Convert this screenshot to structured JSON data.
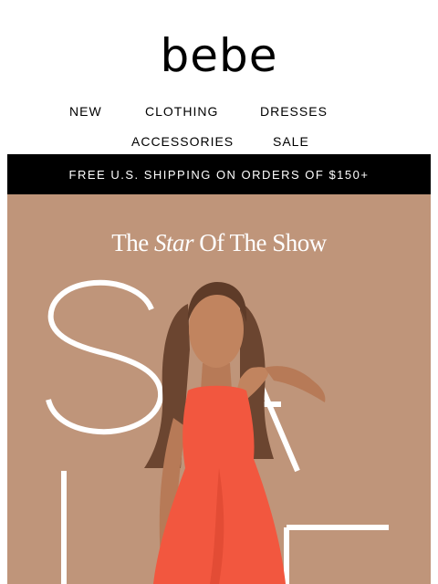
{
  "brand": {
    "logo_text": "bebe"
  },
  "nav": {
    "items": [
      "NEW",
      "CLOTHING",
      "DRESSES",
      "ACCESSORIES",
      "SALE"
    ]
  },
  "promo_banner": {
    "text": "FREE U.S. SHIPPING ON ORDERS OF $150+"
  },
  "hero": {
    "tagline_pre": "The",
    "tagline_emph": "Star",
    "tagline_post": "Of The Show",
    "big_letters": [
      "S",
      "A",
      "L",
      "E"
    ],
    "background_color": "#bf957a",
    "dress_color": "#f2573f"
  }
}
